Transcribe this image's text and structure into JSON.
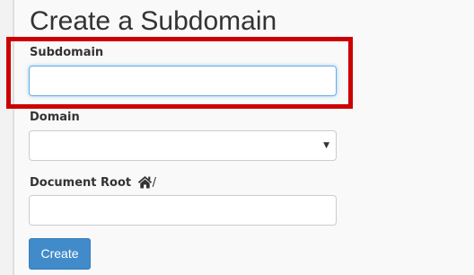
{
  "page": {
    "title": "Create a Subdomain"
  },
  "form": {
    "subdomain": {
      "label": "Subdomain",
      "value": "",
      "placeholder": ""
    },
    "domain": {
      "label": "Domain",
      "selected": ""
    },
    "document_root": {
      "label": "Document Root",
      "prefix_icon": "home-icon",
      "separator": "/",
      "value": "",
      "placeholder": ""
    },
    "submit_label": "Create"
  },
  "annotation": {
    "highlight_color": "#cc0000"
  },
  "colors": {
    "button": "#428bca",
    "focus_border": "#66afe9"
  }
}
